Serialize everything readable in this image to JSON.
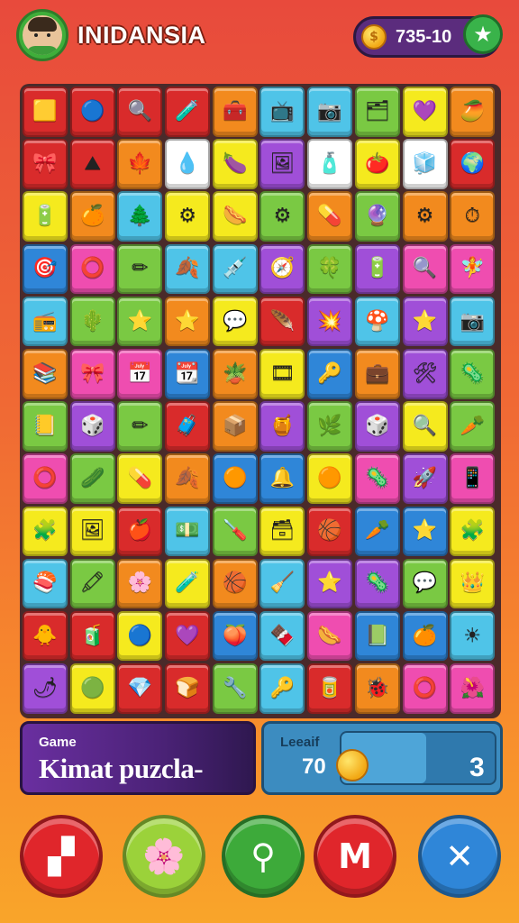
{
  "header": {
    "title": "INIDANSIA",
    "score": "735-10",
    "avatar_icon": "player-avatar",
    "star_icon": "star-icon",
    "coin_icon": "coin-icon"
  },
  "colors": {
    "background_top": "#e84a3c",
    "background_bottom": "#f9a52a",
    "accent_purple": "#5b2c7d",
    "accent_green": "#39b34a",
    "panel_blue": "#3c8cc0"
  },
  "board": {
    "rows": 12,
    "cols": 10,
    "tiles": [
      [
        [
          "#d92b2b",
          "🟨"
        ],
        [
          "#d92b2b",
          "🔵"
        ],
        [
          "#d92b2b",
          "🔍"
        ],
        [
          "#d92b2b",
          "🧪"
        ],
        [
          "#f28a1e",
          "🧰"
        ],
        [
          "#4fc4e8",
          "📺"
        ],
        [
          "#4fc4e8",
          "📷"
        ],
        [
          "#7ac943",
          "🗂"
        ],
        [
          "#f5ea1e",
          "💜"
        ],
        [
          "#f28a1e",
          "🥭"
        ]
      ],
      [
        [
          "#d92b2b",
          "🎀"
        ],
        [
          "#d92b2b",
          "⛰"
        ],
        [
          "#f28a1e",
          "🍁"
        ],
        [
          "#ffffff",
          "💧"
        ],
        [
          "#f5ea1e",
          "🍆"
        ],
        [
          "#a04fd8",
          "🖼"
        ],
        [
          "#ffffff",
          "🧴"
        ],
        [
          "#f5ea1e",
          "🍅"
        ],
        [
          "#ffffff",
          "🧊"
        ],
        [
          "#d92b2b",
          "🌍"
        ]
      ],
      [
        [
          "#f5ea1e",
          "🔋"
        ],
        [
          "#f28a1e",
          "🍊"
        ],
        [
          "#4fc4e8",
          "🌲"
        ],
        [
          "#f5ea1e",
          "⚙"
        ],
        [
          "#f5ea1e",
          "🌭"
        ],
        [
          "#7ac943",
          "⚙"
        ],
        [
          "#f28a1e",
          "💊"
        ],
        [
          "#7ac943",
          "🔮"
        ],
        [
          "#f28a1e",
          "⚙"
        ],
        [
          "#f28a1e",
          "⏱"
        ]
      ],
      [
        [
          "#2f86d8",
          "🎯"
        ],
        [
          "#ef4db0",
          "⭕"
        ],
        [
          "#7ac943",
          "✏"
        ],
        [
          "#4fc4e8",
          "🍂"
        ],
        [
          "#4fc4e8",
          "💉"
        ],
        [
          "#a04fd8",
          "🧭"
        ],
        [
          "#7ac943",
          "🍀"
        ],
        [
          "#a04fd8",
          "🔋"
        ],
        [
          "#ef4db0",
          "🔍"
        ],
        [
          "#ef4db0",
          "🧚"
        ]
      ],
      [
        [
          "#4fc4e8",
          "📻"
        ],
        [
          "#7ac943",
          "🌵"
        ],
        [
          "#7ac943",
          "⭐"
        ],
        [
          "#f28a1e",
          "⭐"
        ],
        [
          "#f5ea1e",
          "💬"
        ],
        [
          "#d92b2b",
          "🪶"
        ],
        [
          "#a04fd8",
          "💥"
        ],
        [
          "#4fc4e8",
          "🍄"
        ],
        [
          "#a04fd8",
          "⭐"
        ],
        [
          "#4fc4e8",
          "📷"
        ]
      ],
      [
        [
          "#f28a1e",
          "📚"
        ],
        [
          "#ef4db0",
          "🎀"
        ],
        [
          "#ef4db0",
          "📅"
        ],
        [
          "#2f86d8",
          "📆"
        ],
        [
          "#f28a1e",
          "🪴"
        ],
        [
          "#f5ea1e",
          "🎞"
        ],
        [
          "#2f86d8",
          "🔑"
        ],
        [
          "#f28a1e",
          "💼"
        ],
        [
          "#a04fd8",
          "🛠"
        ],
        [
          "#7ac943",
          "🦠"
        ]
      ],
      [
        [
          "#7ac943",
          "📒"
        ],
        [
          "#a04fd8",
          "🎲"
        ],
        [
          "#7ac943",
          "✏"
        ],
        [
          "#d92b2b",
          "🧳"
        ],
        [
          "#f28a1e",
          "📦"
        ],
        [
          "#a04fd8",
          "🍯"
        ],
        [
          "#7ac943",
          "🌿"
        ],
        [
          "#a04fd8",
          "🎲"
        ],
        [
          "#f5ea1e",
          "🔍"
        ],
        [
          "#7ac943",
          "🥕"
        ]
      ],
      [
        [
          "#ef4db0",
          "⭕"
        ],
        [
          "#7ac943",
          "🥒"
        ],
        [
          "#f5ea1e",
          "💊"
        ],
        [
          "#f28a1e",
          "🍂"
        ],
        [
          "#2f86d8",
          "🟠"
        ],
        [
          "#2f86d8",
          "🔔"
        ],
        [
          "#f5ea1e",
          "🟠"
        ],
        [
          "#ef4db0",
          "🦠"
        ],
        [
          "#a04fd8",
          "🚀"
        ],
        [
          "#ef4db0",
          "📱"
        ]
      ],
      [
        [
          "#f5ea1e",
          "🧩"
        ],
        [
          "#f5ea1e",
          "🖼"
        ],
        [
          "#d92b2b",
          "🍎"
        ],
        [
          "#4fc4e8",
          "💵"
        ],
        [
          "#7ac943",
          "🪛"
        ],
        [
          "#f5ea1e",
          "🗃"
        ],
        [
          "#d92b2b",
          "🏀"
        ],
        [
          "#2f86d8",
          "🥕"
        ],
        [
          "#2f86d8",
          "⭐"
        ],
        [
          "#f5ea1e",
          "🧩"
        ]
      ],
      [
        [
          "#4fc4e8",
          "🍣"
        ],
        [
          "#7ac943",
          "🖍"
        ],
        [
          "#f28a1e",
          "🌸"
        ],
        [
          "#f5ea1e",
          "🧪"
        ],
        [
          "#f28a1e",
          "🏀"
        ],
        [
          "#4fc4e8",
          "🧹"
        ],
        [
          "#a04fd8",
          "⭐"
        ],
        [
          "#a04fd8",
          "🦠"
        ],
        [
          "#7ac943",
          "💬"
        ],
        [
          "#f5ea1e",
          "👑"
        ]
      ],
      [
        [
          "#d92b2b",
          "🐥"
        ],
        [
          "#d92b2b",
          "🧃"
        ],
        [
          "#f5ea1e",
          "🔵"
        ],
        [
          "#d92b2b",
          "💜"
        ],
        [
          "#2f86d8",
          "🍑"
        ],
        [
          "#4fc4e8",
          "🍫"
        ],
        [
          "#ef4db0",
          "🌭"
        ],
        [
          "#2f86d8",
          "📗"
        ],
        [
          "#2f86d8",
          "🍊"
        ],
        [
          "#4fc4e8",
          "☀"
        ]
      ],
      [
        [
          "#a04fd8",
          "🌶"
        ],
        [
          "#f5ea1e",
          "🟢"
        ],
        [
          "#d92b2b",
          "💎"
        ],
        [
          "#d92b2b",
          "🍞"
        ],
        [
          "#7ac943",
          "🔧"
        ],
        [
          "#4fc4e8",
          "🔑"
        ],
        [
          "#d92b2b",
          "🥫"
        ],
        [
          "#f28a1e",
          "🐞"
        ],
        [
          "#ef4db0",
          "⭕"
        ],
        [
          "#ef4db0",
          "🌺"
        ]
      ]
    ]
  },
  "game_panel": {
    "label": "Game",
    "name": "Kimat puzcla-"
  },
  "level_panel": {
    "label": "Leeaif",
    "value": "70",
    "count": "3",
    "progress": 0.55
  },
  "actions": [
    {
      "name": "action-button-book",
      "icon": "book-icon",
      "glyph": "▞",
      "color": "#e0262b"
    },
    {
      "name": "action-button-flowers",
      "icon": "flowers-icon",
      "glyph": "🌸",
      "color": "#9bd23a"
    },
    {
      "name": "action-button-search",
      "icon": "search-icon",
      "glyph": "⚲",
      "color": "#3daa3a"
    },
    {
      "name": "action-button-mail",
      "icon": "mail-icon",
      "glyph": "M",
      "color": "#e0262b"
    },
    {
      "name": "action-button-close",
      "icon": "close-icon",
      "glyph": "✕",
      "color": "#2f86d8"
    }
  ]
}
